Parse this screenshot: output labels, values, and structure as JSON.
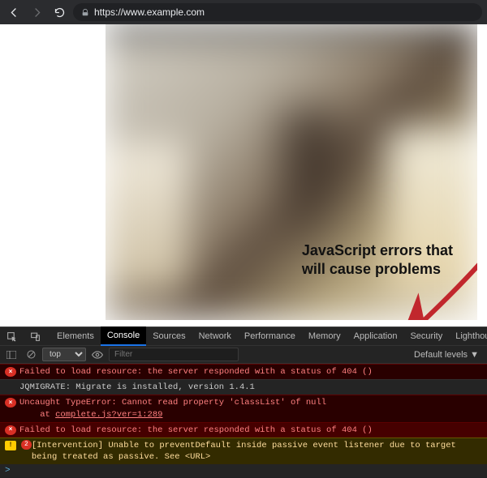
{
  "toolbar": {
    "url": "https://www.example.com"
  },
  "annotation": {
    "line1": "JavaScript errors that",
    "line2": "will cause problems"
  },
  "devtools": {
    "tabs": [
      "Elements",
      "Console",
      "Sources",
      "Network",
      "Performance",
      "Memory",
      "Application",
      "Security",
      "Lighthouse"
    ],
    "active_tab": "Console",
    "context": "top",
    "filter_placeholder": "Filter",
    "levels_label": "Default levels",
    "warn_badge": "2",
    "logs": [
      {
        "kind": "err",
        "icon": "e",
        "text": "Failed to load resource: the server responded with a status of 404 ()"
      },
      {
        "kind": "info",
        "icon": "",
        "text": "JQMIGRATE: Migrate is installed, version 1.4.1"
      },
      {
        "kind": "err",
        "icon": "e",
        "text": "Uncaught TypeError: Cannot read property 'classList' of null",
        "stack": "    at ",
        "stack_link": "complete.js?ver=1:289"
      },
      {
        "kind": "err",
        "icon": "e",
        "sel": true,
        "text": "Failed to load resource: the server responded with a status of 404 ()"
      },
      {
        "kind": "warn",
        "icon": "w",
        "badge": "2",
        "text": "[Intervention] Unable to preventDefault inside passive event listener due to target being treated as passive. See <URL>"
      }
    ],
    "prompt": ">"
  }
}
